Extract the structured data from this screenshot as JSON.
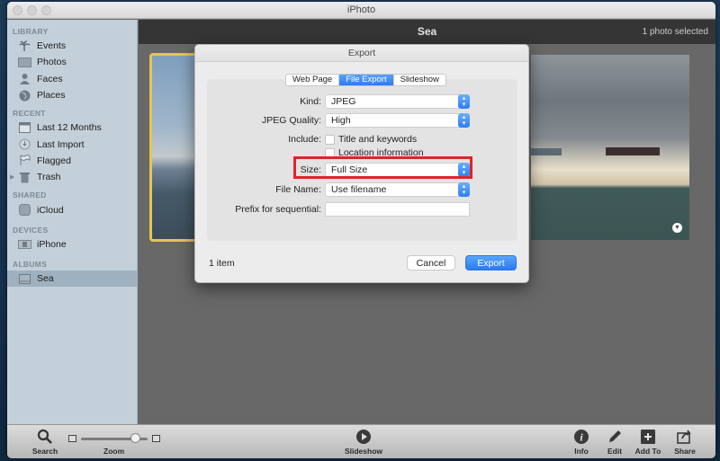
{
  "window": {
    "title": "iPhoto"
  },
  "sidebar": {
    "sections": [
      {
        "heading": "LIBRARY",
        "items": [
          {
            "label": "Events",
            "icon": "events-icon"
          },
          {
            "label": "Photos",
            "icon": "photos-icon"
          },
          {
            "label": "Faces",
            "icon": "faces-icon"
          },
          {
            "label": "Places",
            "icon": "places-icon"
          }
        ]
      },
      {
        "heading": "RECENT",
        "items": [
          {
            "label": "Last 12 Months",
            "icon": "calendar-icon"
          },
          {
            "label": "Last Import",
            "icon": "import-icon"
          },
          {
            "label": "Flagged",
            "icon": "flag-icon"
          },
          {
            "label": "Trash",
            "icon": "trash-icon"
          }
        ]
      },
      {
        "heading": "SHARED",
        "items": [
          {
            "label": "iCloud",
            "icon": "icloud-icon"
          }
        ]
      },
      {
        "heading": "DEVICES",
        "items": [
          {
            "label": "iPhone",
            "icon": "iphone-icon"
          }
        ]
      },
      {
        "heading": "ALBUMS",
        "items": [
          {
            "label": "Sea",
            "icon": "album-icon",
            "selected": true
          }
        ]
      }
    ]
  },
  "topbar": {
    "title": "Sea",
    "selection_count": "1 photo selected"
  },
  "dialog": {
    "title": "Export",
    "tabs": [
      {
        "label": "Web Page",
        "active": false
      },
      {
        "label": "File Export",
        "active": true
      },
      {
        "label": "Slideshow",
        "active": false
      }
    ],
    "kind": {
      "label": "Kind:",
      "value": "JPEG"
    },
    "jpeg_quality": {
      "label": "JPEG Quality:",
      "value": "High"
    },
    "include": {
      "label": "Include:",
      "options": [
        {
          "label": "Title and keywords",
          "checked": false
        },
        {
          "label": "Location information",
          "checked": false
        }
      ]
    },
    "size": {
      "label": "Size:",
      "value": "Full Size"
    },
    "file_name": {
      "label": "File Name:",
      "value": "Use filename"
    },
    "prefix": {
      "label": "Prefix for sequential:",
      "value": "",
      "placeholder": ""
    },
    "item_count": "1 item",
    "cancel_label": "Cancel",
    "export_label": "Export",
    "accent_color": "#2d7cf4",
    "highlight_color": "#e0232a"
  },
  "toolbar": {
    "search_label": "Search",
    "zoom_label": "Zoom",
    "zoom_level": 0.88,
    "slideshow_label": "Slideshow",
    "info_label": "Info",
    "edit_label": "Edit",
    "add_to_label": "Add To",
    "share_label": "Share"
  }
}
